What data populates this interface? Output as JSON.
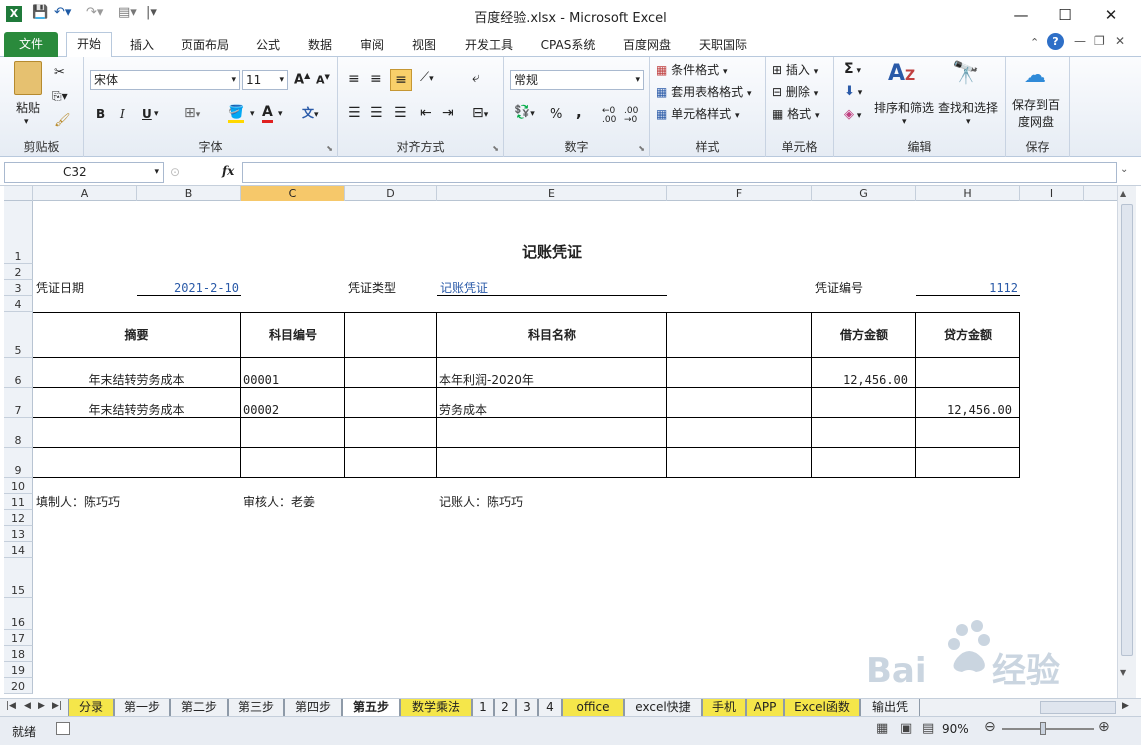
{
  "window": {
    "title": "百度经验.xlsx  -  Microsoft Excel",
    "app_icon": "excel-icon",
    "controls": [
      "minimize",
      "maximize",
      "close"
    ]
  },
  "ribbon_tabs": [
    "文件",
    "开始",
    "插入",
    "页面布局",
    "公式",
    "数据",
    "审阅",
    "视图",
    "开发工具",
    "CPAS系统",
    "百度网盘",
    "天职国际"
  ],
  "active_tab": "开始",
  "ribbon": {
    "clipboard": {
      "paste": "粘贴",
      "label": "剪贴板"
    },
    "font": {
      "name": "宋体",
      "size": "11",
      "label": "字体",
      "bold": "B",
      "italic": "I",
      "underline": "U"
    },
    "alignment": {
      "label": "对齐方式"
    },
    "number": {
      "format": "常规",
      "label": "数字",
      "percent": "%",
      "comma": ","
    },
    "styles": {
      "conditional": "条件格式",
      "table": "套用表格格式",
      "cell": "单元格样式",
      "label": "样式"
    },
    "cells": {
      "insert": "插入",
      "delete": "删除",
      "format": "格式",
      "label": "单元格"
    },
    "editing": {
      "sort": "排序和筛选",
      "find": "查找和选择",
      "label": "编辑",
      "sum": "Σ"
    },
    "save": {
      "button_line1": "保存到百",
      "button_line2": "度网盘",
      "label": "保存"
    }
  },
  "formula_bar": {
    "name_box": "C32",
    "fx": "fx",
    "value": ""
  },
  "columns": [
    "A",
    "B",
    "C",
    "D",
    "E",
    "F",
    "G",
    "H",
    "I"
  ],
  "selected_column": "C",
  "rows": [
    "1",
    "2",
    "3",
    "4",
    "5",
    "6",
    "7",
    "8",
    "9",
    "10",
    "11",
    "12",
    "13",
    "14",
    "15",
    "16",
    "17",
    "18",
    "19",
    "20"
  ],
  "voucher": {
    "title": "记账凭证",
    "date_label": "凭证日期",
    "date_value": "2021-2-10",
    "type_label": "凭证类型",
    "type_value": "记账凭证",
    "number_label": "凭证编号",
    "number_value": "1112",
    "headers": {
      "summary": "摘要",
      "account_code": "科目编号",
      "account_name": "科目名称",
      "debit": "借方金额",
      "credit": "贷方金额"
    },
    "entries": [
      {
        "summary": "年末结转劳务成本",
        "code": "00001",
        "name": "本年利润-2020年",
        "debit": "12,456.00",
        "credit": ""
      },
      {
        "summary": "年末结转劳务成本",
        "code": "00002",
        "name": "劳务成本",
        "debit": "",
        "credit": "12,456.00"
      }
    ],
    "prepared_by": "填制人：陈巧巧",
    "reviewed_by": "审核人：老姜",
    "posted_by": "记账人：陈巧巧"
  },
  "sheet_tabs": [
    "分录",
    "第一步",
    "第二步",
    "第三步",
    "第四步",
    "第五步",
    "数学乘法",
    "1",
    "2",
    "3",
    "4",
    "office",
    "excel快捷",
    "手机",
    "APP",
    "Excel函数",
    "输出凭"
  ],
  "active_sheet": "第五步",
  "status": {
    "ready": "就绪",
    "zoom": "90%"
  },
  "watermark": "Baidu经验"
}
